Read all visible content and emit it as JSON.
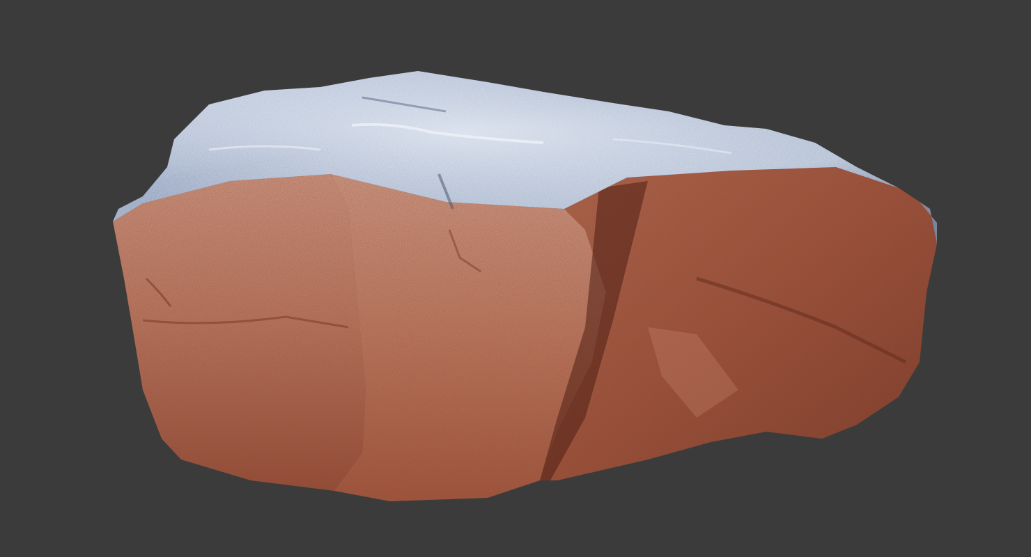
{
  "viewport": {
    "background_color": "#3b3b3b"
  },
  "model": {
    "subject": "rock-3d-model",
    "colors": {
      "top_surface": "#8e9fbd",
      "top_highlight": "#d9e2ef",
      "face_light": "#d08a72",
      "face_mid": "#b0593f",
      "face_dark": "#7a3422",
      "shadow_band": "#6a3222"
    }
  }
}
